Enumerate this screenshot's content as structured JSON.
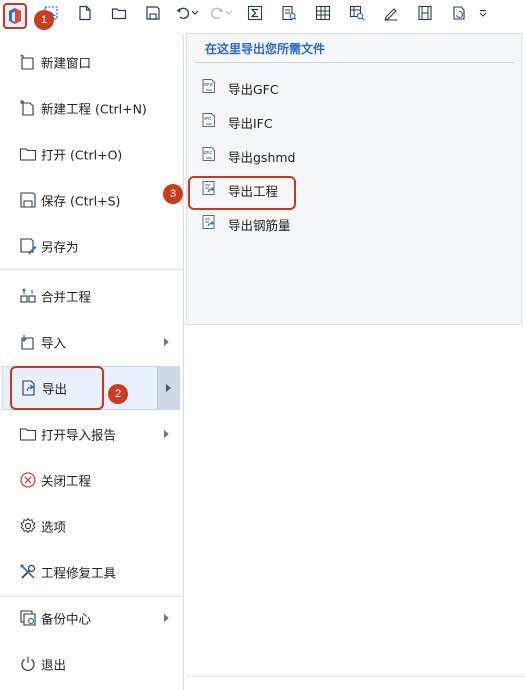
{
  "toolbar": {
    "items": [
      "app-menu-icon",
      "select-icon",
      "new-file-icon",
      "open-folder-icon",
      "save-icon",
      "undo-icon",
      "undo-dropdown",
      "redo-icon",
      "redo-dropdown",
      "sigma-icon",
      "report-icon",
      "table-icon",
      "find-table-icon",
      "edit-pen-icon",
      "film-icon",
      "refresh-export-icon",
      "more-dropdown-icon"
    ]
  },
  "menu": {
    "items": [
      {
        "label": "新建窗口",
        "icon": "new-window-icon",
        "arrow": false
      },
      {
        "label": "新建工程 (Ctrl+N)",
        "icon": "new-project-icon",
        "arrow": false
      },
      {
        "label": "打开 (Ctrl+O)",
        "icon": "open-folder-icon",
        "arrow": false
      },
      {
        "label": "保存 (Ctrl+S)",
        "icon": "save-icon",
        "arrow": false
      },
      {
        "label": "另存为",
        "icon": "save-as-icon",
        "arrow": false
      },
      {
        "label": "合并工程",
        "icon": "merge-icon",
        "arrow": false
      },
      {
        "label": "导入",
        "icon": "import-icon",
        "arrow": true
      },
      {
        "label": "导出",
        "icon": "export-icon",
        "arrow": true
      },
      {
        "label": "打开导入报告",
        "icon": "open-report-icon",
        "arrow": true
      },
      {
        "label": "关闭工程",
        "icon": "close-icon",
        "arrow": false
      },
      {
        "label": "选项",
        "icon": "gear-icon",
        "arrow": false
      },
      {
        "label": "工程修复工具",
        "icon": "repair-tools-icon",
        "arrow": false
      },
      {
        "label": "备份中心",
        "icon": "backup-icon",
        "arrow": true
      },
      {
        "label": "退出",
        "icon": "power-icon",
        "arrow": false
      }
    ]
  },
  "submenu": {
    "header": "在这里导出您所需文件",
    "items": [
      {
        "label": "导出GFC",
        "icon": "gfc-file-icon"
      },
      {
        "label": "导出IFC",
        "icon": "ifc-file-icon"
      },
      {
        "label": "导出gshmd",
        "icon": "zfc-file-icon"
      },
      {
        "label": "导出工程",
        "icon": "export-project-icon"
      },
      {
        "label": "导出钢筋量",
        "icon": "export-rebar-icon"
      }
    ]
  },
  "callouts": {
    "badge1": "1",
    "badge2": "2",
    "badge3": "3"
  },
  "colors": {
    "accent": "#2b6bc8",
    "callout": "#c8391f",
    "active_bg": "#e8f1fc"
  }
}
